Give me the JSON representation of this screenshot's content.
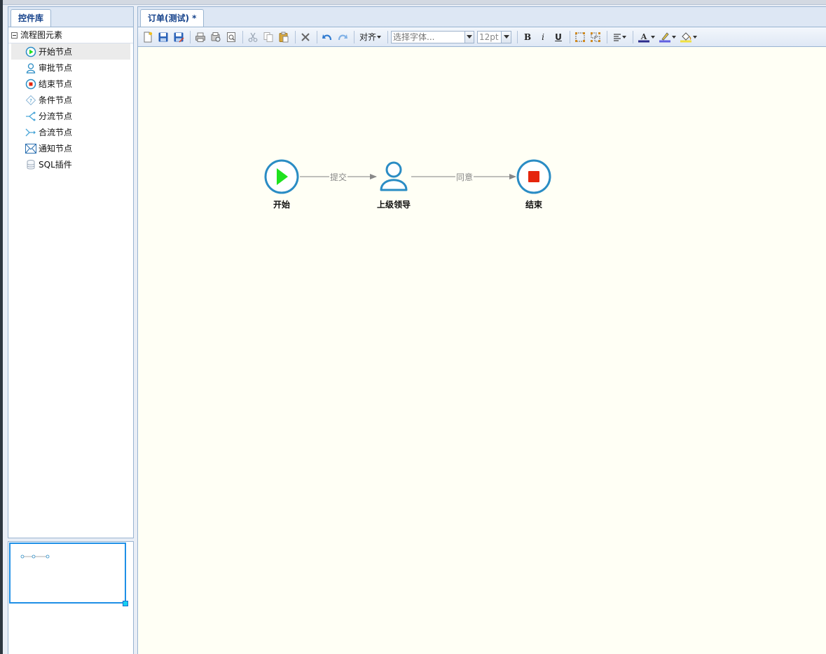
{
  "library": {
    "tab_label": "控件库",
    "group_label": "流程图元素",
    "items": [
      {
        "label": "开始节点",
        "icon": "start-node-icon"
      },
      {
        "label": "审批节点",
        "icon": "approval-node-icon"
      },
      {
        "label": "结束节点",
        "icon": "end-node-icon"
      },
      {
        "label": "条件节点",
        "icon": "condition-node-icon"
      },
      {
        "label": "分流节点",
        "icon": "fork-node-icon"
      },
      {
        "label": "合流节点",
        "icon": "join-node-icon"
      },
      {
        "label": "通知节点",
        "icon": "notify-node-icon"
      },
      {
        "label": "SQL插件",
        "icon": "sql-plugin-icon"
      }
    ]
  },
  "editor": {
    "tab_label": "订单(测试) *",
    "toolbar": {
      "align_label": "对齐",
      "font_placeholder": "选择字体...",
      "font_size": "12pt",
      "bold_label": "B",
      "italic_label": "i",
      "underline_label": "U"
    }
  },
  "flow": {
    "nodes": [
      {
        "id": "start",
        "label": "开始",
        "type": "start"
      },
      {
        "id": "leader",
        "label": "上级领导",
        "type": "approval"
      },
      {
        "id": "end",
        "label": "结束",
        "type": "end"
      }
    ],
    "edges": [
      {
        "from": "start",
        "to": "leader",
        "label": "提交"
      },
      {
        "from": "leader",
        "to": "end",
        "label": "同意"
      }
    ]
  },
  "colors": {
    "accent": "#2a8cc4",
    "start_green": "#1fe21f",
    "end_red": "#e5250d",
    "canvas_bg": "#fffff5"
  }
}
